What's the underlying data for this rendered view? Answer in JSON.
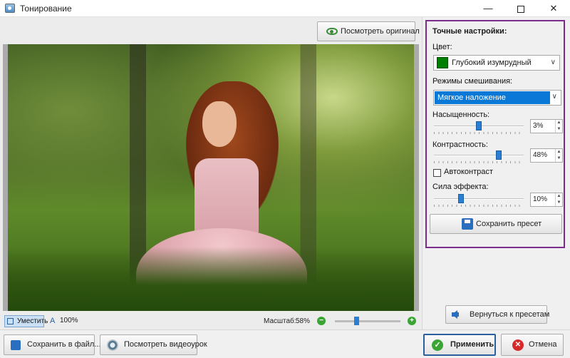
{
  "window": {
    "title": "Тонирование",
    "min_glyph": "—",
    "close_glyph": "✕",
    "icon": "app-photo-icon"
  },
  "preview": {
    "view_original_label": "Посмотреть оригинал",
    "fit_label": "Уместить",
    "zoom100_label": "100%",
    "zoom100_glyph": "A",
    "scale_label": "Масштаб:",
    "scale_value": "58%",
    "scale_level": 0.58,
    "zoom_minus_glyph": "−",
    "zoom_plus_glyph": "+"
  },
  "settings": {
    "title": "Точные настройки:",
    "color_label": "Цвет:",
    "color_value": "Глубокий изумрудный",
    "color_swatch": "#008000",
    "blend_label": "Режимы смешивания:",
    "blend_value": "Мягкое наложение",
    "saturation_label": "Насыщенность:",
    "saturation_value": "3%",
    "saturation_level": 0.5,
    "contrast_label": "Контрастность:",
    "contrast_value": "48%",
    "contrast_level": 0.72,
    "autocontrast_label": "Автоконтраст",
    "autocontrast_checked": false,
    "effect_label": "Сила эффекта:",
    "effect_value": "10%",
    "effect_level": 0.3,
    "save_preset_label": "Сохранить пресет",
    "dropdown_glyph": "∨",
    "spin_up": "▲",
    "spin_down": "▼"
  },
  "back_to_presets_label": "Вернуться к пресетам",
  "footer": {
    "save_file_label": "Сохранить в файл...",
    "video_label": "Посмотреть видеоурок",
    "apply_label": "Применить",
    "apply_glyph": "✓",
    "cancel_label": "Отмена",
    "cancel_glyph": "✕"
  },
  "colors": {
    "accent_blue": "#0a78d7",
    "highlight_border": "#7b2d8e",
    "apply_green": "#3aa535",
    "cancel_red": "#d42a2a"
  }
}
